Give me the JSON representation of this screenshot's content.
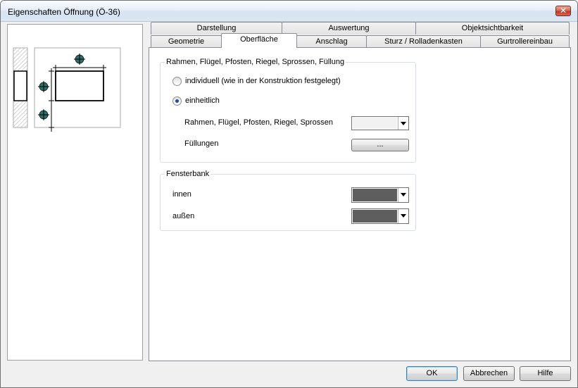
{
  "window": {
    "title": "Eigenschaften Öffnung (Ö-36)",
    "close_symbol": "✕"
  },
  "tabs": {
    "row_top": [
      {
        "label": "Darstellung"
      },
      {
        "label": "Auswertung"
      },
      {
        "label": "Objektsichtbarkeit"
      }
    ],
    "row_bottom": [
      {
        "label": "Geometrie"
      },
      {
        "label": "Oberfläche",
        "active": true
      },
      {
        "label": "Anschlag"
      },
      {
        "label": "Sturz / Rolladenkasten"
      },
      {
        "label": "Gurtrollereinbau"
      }
    ]
  },
  "surface_group": {
    "legend": "Rahmen, Flügel, Pfosten, Riegel, Sprossen, Füllung",
    "option_individual": "individuell (wie in der Konstruktion festgelegt)",
    "option_uniform": "einheitlich",
    "selected": "einheitlich",
    "frame_label": "Rahmen, Flügel, Pfosten, Riegel, Sprossen",
    "frame_color": "#f2f2f2",
    "fillings_label": "Füllungen",
    "fillings_button": "..."
  },
  "sill_group": {
    "legend": "Fensterbank",
    "inner_label": "innen",
    "inner_color": "#5e5e5e",
    "outer_label": "außen",
    "outer_color": "#5e5e5e"
  },
  "footer": {
    "ok": "OK",
    "cancel": "Abbrechen",
    "help": "Hilfe"
  },
  "icons": {
    "preview": "window-opening-preview-icon",
    "marker": "crosshair-marker-icon"
  }
}
